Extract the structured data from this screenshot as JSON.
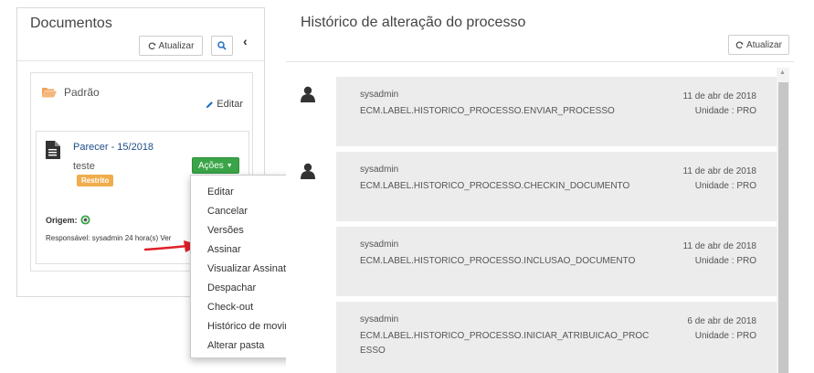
{
  "documentos": {
    "title": "Documentos",
    "refresh_label": "Atualizar",
    "folder": {
      "name": "Padrão",
      "edit_label": "Editar"
    },
    "document": {
      "title": "Parecer - 15/2018",
      "description": "teste",
      "badge": "Restrito",
      "actions_label": "Ações",
      "origin_label": "Origem:",
      "responsible_text": "Responsável: sysadmin 24 hora(s) Ver"
    }
  },
  "actions_menu": {
    "items": [
      "Editar",
      "Cancelar",
      "Versões",
      "Assinar",
      "Visualizar Assinatura",
      "Despachar",
      "Check-out",
      "Histórico de movimentação",
      "Alterar pasta"
    ]
  },
  "historico": {
    "title": "Histórico de alteração do processo",
    "refresh_label": "Atualizar",
    "entries": [
      {
        "user": "sysadmin",
        "action": "ECM.LABEL.HISTORICO_PROCESSO.ENVIAR_PROCESSO",
        "date": "11 de abr de 2018",
        "unit": "Unidade : PRO"
      },
      {
        "user": "sysadmin",
        "action": "ECM.LABEL.HISTORICO_PROCESSO.CHECKIN_DOCUMENTO",
        "date": "11 de abr de 2018",
        "unit": "Unidade : PRO"
      },
      {
        "user": "sysadmin",
        "action": "ECM.LABEL.HISTORICO_PROCESSO.INCLUSAO_DOCUMENTO",
        "date": "11 de abr de 2018",
        "unit": "Unidade : PRO"
      },
      {
        "user": "sysadmin",
        "action": "ECM.LABEL.HISTORICO_PROCESSO.INICIAR_ATRIBUICAO_PROC ESSO",
        "date": "6 de abr de 2018",
        "unit": "Unidade : PRO"
      }
    ]
  },
  "colors": {
    "accent_green": "#3aa548",
    "badge_orange": "#f0ad4e",
    "link_blue": "#1f4d89",
    "folder_orange": "#f0a35a",
    "arrow_red": "#e0202a"
  },
  "icons": {
    "refresh": "refresh-icon",
    "search": "search-icon",
    "collapse": "chevron-left-icon",
    "folder": "folder-open-icon",
    "edit": "pencil-icon",
    "document": "document-icon",
    "user": "user-icon"
  }
}
